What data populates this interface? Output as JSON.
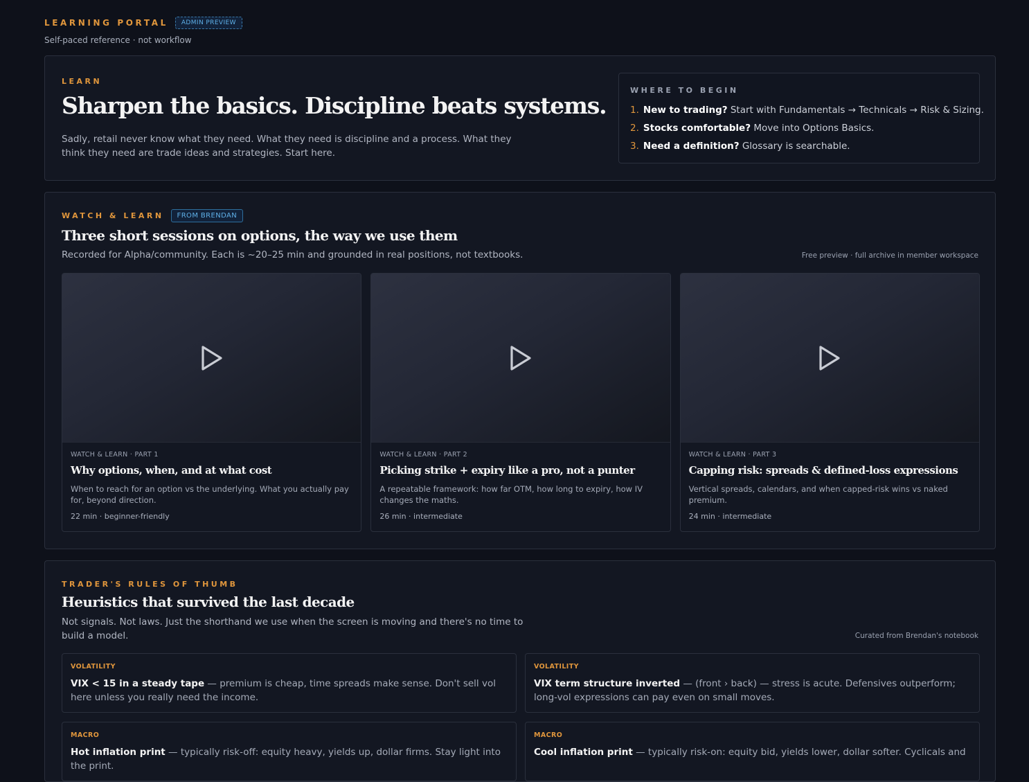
{
  "portal": {
    "title": "LEARNING PORTAL",
    "badge": "ADMIN PREVIEW",
    "subtitle": "Self-paced reference · not workflow"
  },
  "learn": {
    "eyebrow": "LEARN",
    "headline": "Sharpen the basics. Discipline beats systems.",
    "lede": "Sadly, retail never know what they need. What they need is discipline and a process. What they think they need are trade ideas and strategies. Start here.",
    "begin": {
      "title": "WHERE TO BEGIN",
      "items": [
        {
          "num": "1.",
          "bold": "New to trading?",
          "text": " Start with Fundamentals → Technicals → Risk & Sizing."
        },
        {
          "num": "2.",
          "bold": "Stocks comfortable?",
          "text": " Move into Options Basics."
        },
        {
          "num": "3.",
          "bold": "Need a definition?",
          "text": " Glossary is searchable."
        }
      ]
    }
  },
  "watch": {
    "eyebrow": "WATCH & LEARN",
    "badge": "FROM BRENDAN",
    "title": "Three short sessions on options, the way we use them",
    "subtitle": "Recorded for Alpha/community. Each is ~20–25 min and grounded in real positions, not textbooks.",
    "note": "Free preview · full archive in member workspace",
    "videos": [
      {
        "meta": "WATCH & LEARN · PART 1",
        "title": "Why options, when, and at what cost",
        "desc": "When to reach for an option vs the underlying. What you actually pay for, beyond direction.",
        "duration": "22 min · beginner-friendly"
      },
      {
        "meta": "WATCH & LEARN · PART 2",
        "title": "Picking strike + expiry like a pro, not a punter",
        "desc": "A repeatable framework: how far OTM, how long to expiry, how IV changes the maths.",
        "duration": "26 min · intermediate"
      },
      {
        "meta": "WATCH & LEARN · PART 3",
        "title": "Capping risk: spreads & defined-loss expressions",
        "desc": "Vertical spreads, calendars, and when capped-risk wins vs naked premium.",
        "duration": "24 min · intermediate"
      }
    ]
  },
  "rules": {
    "eyebrow": "TRADER'S RULES OF THUMB",
    "title": "Heuristics that survived the last decade",
    "subtitle": "Not signals. Not laws. Just the shorthand we use when the screen is moving and there's no time to build a model.",
    "note": "Curated from Brendan's notebook",
    "items": [
      {
        "tag": "VOLATILITY",
        "bold": "VIX < 15 in a steady tape",
        "text": " — premium is cheap, time spreads make sense. Don't sell vol here unless you really need the income."
      },
      {
        "tag": "VOLATILITY",
        "bold": "VIX term structure inverted",
        "text": " — (front › back) — stress is acute. Defensives outperform; long-vol expressions can pay even on small moves."
      },
      {
        "tag": "MACRO",
        "bold": "Hot inflation print",
        "text": " — typically risk-off: equity heavy, yields up, dollar firms. Stay light into the print."
      },
      {
        "tag": "MACRO",
        "bold": "Cool inflation print",
        "text": " — typically risk-on: equity bid, yields lower, dollar softer. Cyclicals and"
      }
    ]
  }
}
